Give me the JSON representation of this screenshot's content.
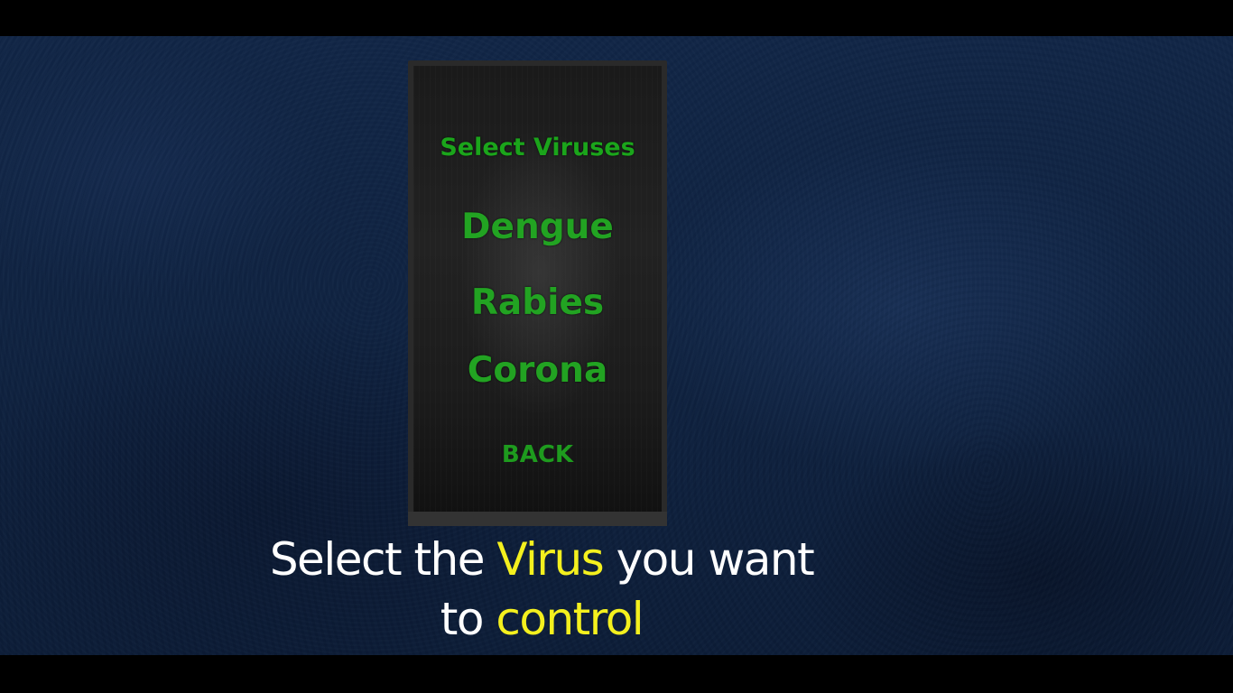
{
  "menu": {
    "title": "Select Viruses",
    "items": [
      {
        "label": "Dengue"
      },
      {
        "label": "Rabies"
      },
      {
        "label": "Corona"
      }
    ],
    "back_label": "BACK"
  },
  "caption": {
    "line1_part1": "Select the ",
    "line1_highlight": "Virus",
    "line1_part2": " you want",
    "line2_part1": "to ",
    "line2_highlight": "control"
  },
  "colors": {
    "menu_text": "#22a322",
    "caption_text": "#ffffff",
    "caption_highlight": "#f4f01e",
    "background": "#112647"
  }
}
